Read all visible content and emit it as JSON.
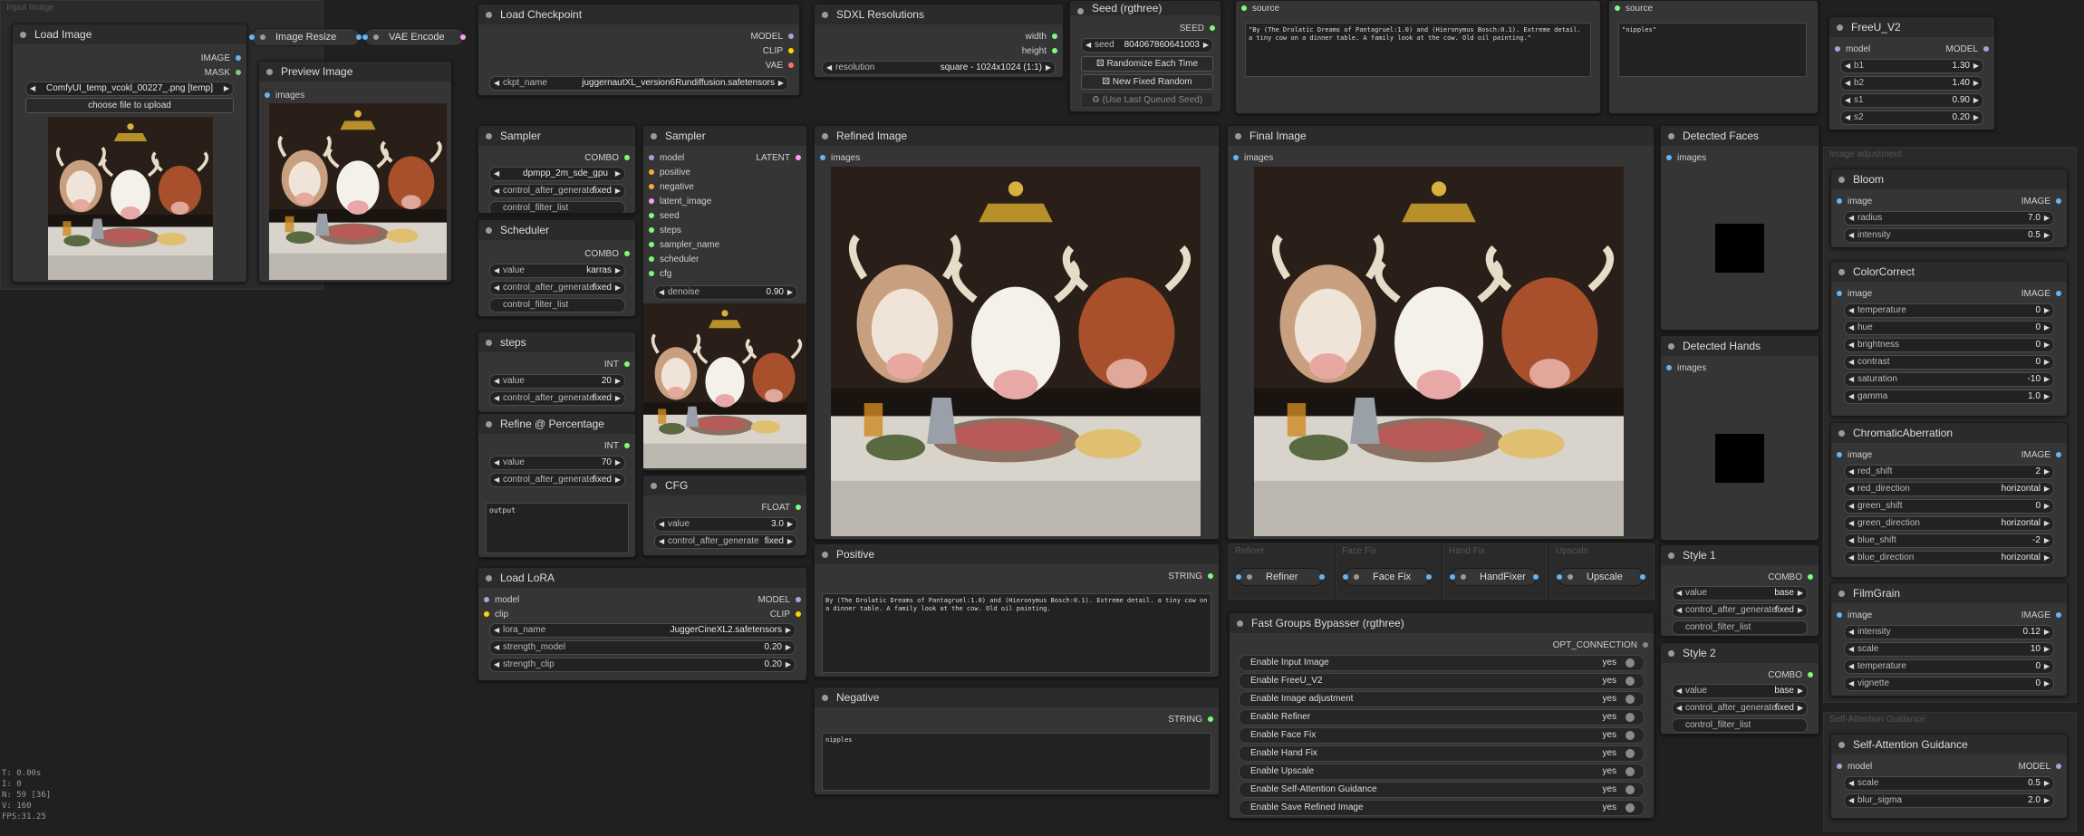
{
  "colors": {
    "image": "#64b5f6",
    "mask": "#81c784",
    "model": "#b39ddb",
    "clip": "#ffd500",
    "vae": "#ff6e6e",
    "latent": "#ff9cf9",
    "conditioning": "#ffa931",
    "int": "#7cfc7c",
    "string": "#7cfc7c",
    "combo": "#7cfc7c"
  },
  "groups": {
    "input_image": "Input Image",
    "image_adjustment": "Image adjustment",
    "self_attention": "Self-Attention Guidance"
  },
  "load_image": {
    "title": "Load Image",
    "out_image": "IMAGE",
    "out_mask": "MASK",
    "file": "ComfyUI_temp_vcokl_00227_.png [temp]",
    "upload": "choose file to upload"
  },
  "image_resize": {
    "title": "Image Resize"
  },
  "vae_encode": {
    "title": "VAE Encode"
  },
  "preview": {
    "title": "Preview Image",
    "in_images": "images"
  },
  "checkpoint": {
    "title": "Load Checkpoint",
    "out_model": "MODEL",
    "out_clip": "CLIP",
    "out_vae": "VAE",
    "label": "ckpt_name",
    "value": "juggernautXL_version6Rundiffusion.safetensors"
  },
  "sdxl": {
    "title": "SDXL Resolutions",
    "out_width": "width",
    "out_height": "height",
    "label": "resolution",
    "value": "square - 1024x1024 (1:1)"
  },
  "seed": {
    "title": "Seed (rgthree)",
    "out": "SEED",
    "label": "seed",
    "value": "804067860641003",
    "btn_random": "Randomize Each Time",
    "btn_fixed": "New Fixed Random",
    "btn_last": "(Use Last Queued Seed)"
  },
  "source1": {
    "in": "source",
    "text": "\"By (The Drolatic Dreams of Pantagruel:1.0) and (Hieronymus Bosch:0.1). Extreme detail. a tiny cow on a dinner table. A family look at the cow. Old oil painting.\""
  },
  "source2": {
    "in": "source",
    "text": "\"nipples\""
  },
  "sampler_sel": {
    "title": "Sampler",
    "out": "COMBO",
    "value": "dpmpp_2m_sde_gpu",
    "control_label": "control_after_generate",
    "control_value": "fixed",
    "filter": "control_filter_list"
  },
  "scheduler": {
    "title": "Scheduler",
    "out": "COMBO",
    "label": "value",
    "value": "karras",
    "control_label": "control_after_generate",
    "control_value": "fixed",
    "filter": "control_filter_list"
  },
  "steps": {
    "title": "steps",
    "out": "INT",
    "label": "value",
    "value": "20",
    "control_label": "control_after_generate",
    "control_value": "fixed"
  },
  "refine_pct": {
    "title": "Refine @ Percentage",
    "out": "INT",
    "label": "value",
    "value": "70",
    "control_label": "control_after_generate",
    "control_value": "fixed",
    "output": "output"
  },
  "sampler": {
    "title": "Sampler",
    "out": "LATENT",
    "inputs": [
      "model",
      "positive",
      "negative",
      "latent_image",
      "seed",
      "steps",
      "sampler_name",
      "scheduler",
      "cfg"
    ],
    "denoise_label": "denoise",
    "denoise_value": "0.90"
  },
  "cfg": {
    "title": "CFG",
    "out": "FLOAT",
    "label": "value",
    "value": "3.0",
    "control_label": "control_after_generate",
    "control_value": "fixed"
  },
  "lora": {
    "title": "Load LoRA",
    "out_model": "MODEL",
    "out_clip": "CLIP",
    "in_model": "model",
    "in_clip": "clip",
    "name_label": "lora_name",
    "name_value": "JuggerCineXL2.safetensors",
    "sm_label": "strength_model",
    "sm_value": "0.20",
    "sc_label": "strength_clip",
    "sc_value": "0.20"
  },
  "refined": {
    "title": "Refined Image",
    "in": "images"
  },
  "final": {
    "title": "Final Image",
    "in": "images"
  },
  "positive": {
    "title": "Positive",
    "out": "STRING",
    "text": "By (The Drolatic Dreams of Pantagruel:1.0) and (Hieronymus Bosch:0.1). Extreme detail. a tiny cow on a dinner table. A family look at the cow. Old oil painting."
  },
  "negative": {
    "title": "Negative",
    "out": "STRING",
    "text": "nipples"
  },
  "faces": {
    "title": "Detected Faces",
    "in": "images"
  },
  "hands": {
    "title": "Detected Hands",
    "in": "images"
  },
  "collapsed": [
    "Refiner",
    "Face Fix",
    "HandFixer",
    "Upscale"
  ],
  "mini_groups": [
    "Refiner",
    "Face Fix",
    "Hand Fix",
    "Upscale"
  ],
  "bypasser": {
    "title": "Fast Groups Bypasser (rgthree)",
    "out": "OPT_CONNECTION",
    "yes": "yes",
    "items": [
      "Enable Input Image",
      "Enable FreeU_V2",
      "Enable Image adjustment",
      "Enable Refiner",
      "Enable Face Fix",
      "Enable Hand Fix",
      "Enable Upscale",
      "Enable Self-Attention Guidance",
      "Enable Save Refined Image"
    ]
  },
  "style1": {
    "title": "Style 1",
    "out": "COMBO",
    "label": "value",
    "value": "base",
    "control_label": "control_after_generate",
    "control_value": "fixed",
    "filter": "control_filter_list"
  },
  "style2": {
    "title": "Style 2",
    "out": "COMBO",
    "label": "value",
    "value": "base",
    "control_label": "control_after_generate",
    "control_value": "fixed",
    "filter": "control_filter_list"
  },
  "freeu": {
    "title": "FreeU_V2",
    "in": "model",
    "out": "MODEL",
    "params": [
      {
        "label": "b1",
        "value": "1.30"
      },
      {
        "label": "b2",
        "value": "1.40"
      },
      {
        "label": "s1",
        "value": "0.90"
      },
      {
        "label": "s2",
        "value": "0.20"
      }
    ]
  },
  "bloom": {
    "title": "Bloom",
    "in": "image",
    "out": "IMAGE",
    "params": [
      {
        "label": "radius",
        "value": "7.0"
      },
      {
        "label": "intensity",
        "value": "0.5"
      }
    ]
  },
  "colorcorrect": {
    "title": "ColorCorrect",
    "in": "image",
    "out": "IMAGE",
    "params": [
      {
        "label": "temperature",
        "value": "0"
      },
      {
        "label": "hue",
        "value": "0"
      },
      {
        "label": "brightness",
        "value": "0"
      },
      {
        "label": "contrast",
        "value": "0"
      },
      {
        "label": "saturation",
        "value": "-10"
      },
      {
        "label": "gamma",
        "value": "1.0"
      }
    ]
  },
  "chromatic": {
    "title": "ChromaticAberration",
    "in": "image",
    "out": "IMAGE",
    "params": [
      {
        "label": "red_shift",
        "value": "2"
      },
      {
        "label": "red_direction",
        "value": "horizontal"
      },
      {
        "label": "green_shift",
        "value": "0"
      },
      {
        "label": "green_direction",
        "value": "horizontal"
      },
      {
        "label": "blue_shift",
        "value": "-2"
      },
      {
        "label": "blue_direction",
        "value": "horizontal"
      }
    ]
  },
  "filmgrain": {
    "title": "FilmGrain",
    "in": "image",
    "out": "IMAGE",
    "params": [
      {
        "label": "intensity",
        "value": "0.12"
      },
      {
        "label": "scale",
        "value": "10"
      },
      {
        "label": "temperature",
        "value": "0"
      },
      {
        "label": "vignette",
        "value": "0"
      }
    ]
  },
  "sag": {
    "title": "Self-Attention Guidance",
    "in": "model",
    "out": "MODEL",
    "params": [
      {
        "label": "scale",
        "value": "0.5"
      },
      {
        "label": "blur_sigma",
        "value": "2.0"
      }
    ]
  },
  "stats": [
    "T: 0.00s",
    "I: 0",
    "N: 59 [36]",
    "V: 160",
    "FPS:31.25"
  ]
}
